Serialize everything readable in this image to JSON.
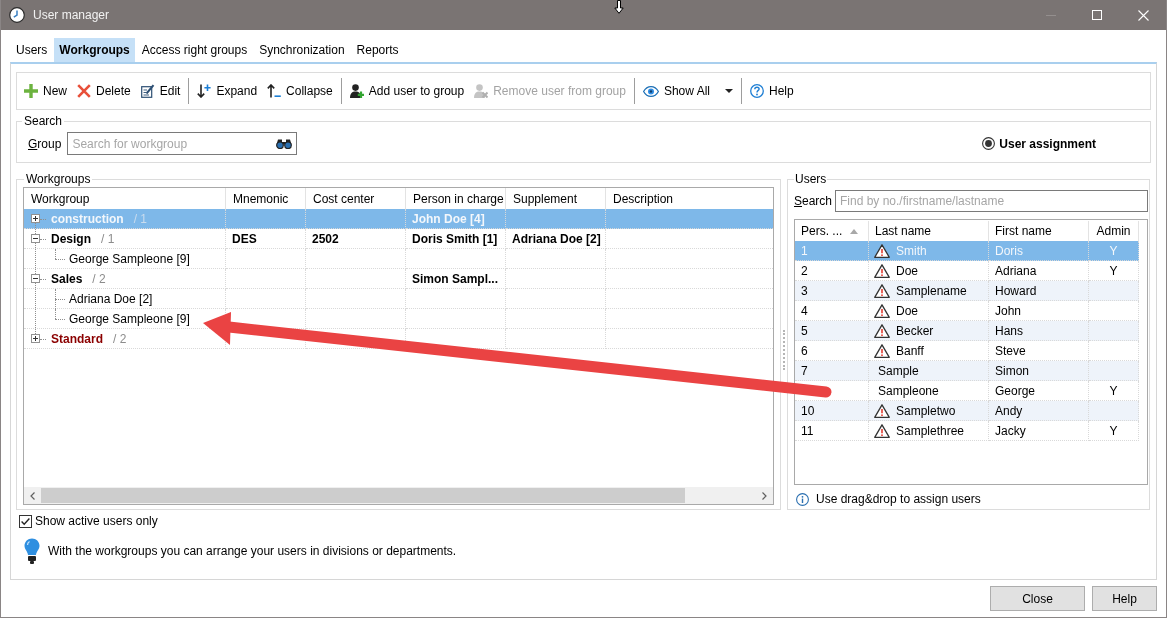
{
  "window": {
    "title": "User manager"
  },
  "tabs": [
    {
      "label": "Users",
      "selected": false
    },
    {
      "label": "Workgroups",
      "selected": true
    },
    {
      "label": "Access right groups",
      "selected": false
    },
    {
      "label": "Synchronization",
      "selected": false
    },
    {
      "label": "Reports",
      "selected": false
    }
  ],
  "toolbar": [
    {
      "items": [
        {
          "label": "New",
          "kind": "button",
          "disabled": false
        },
        {
          "label": "Delete",
          "kind": "button",
          "disabled": false
        },
        {
          "label": "Edit",
          "kind": "button",
          "disabled": false
        }
      ]
    },
    {
      "items": [
        {
          "label": "Expand",
          "kind": "button",
          "disabled": false
        },
        {
          "label": "Collapse",
          "kind": "button",
          "disabled": false
        }
      ]
    },
    {
      "items": [
        {
          "label": "Add user to group",
          "kind": "button",
          "disabled": false
        },
        {
          "label": "Remove user from group",
          "kind": "button",
          "disabled": true
        }
      ]
    },
    {
      "items": [
        {
          "label": "Show All",
          "kind": "split",
          "disabled": false
        }
      ]
    },
    {
      "items": [
        {
          "label": "Help",
          "kind": "button",
          "disabled": false
        }
      ]
    }
  ],
  "search": {
    "legend": "Search",
    "label": "Group",
    "placeholder": "Search for workgroup",
    "option": {
      "label": "User assignment",
      "selected": true
    }
  },
  "workgroups": {
    "legend": "Workgroups",
    "columns": [
      "Workgroup",
      "Mnemonic",
      "Cost center",
      "Person in charge",
      "Supplement",
      "Description"
    ],
    "groups": [
      {
        "name": "construction",
        "count": "/ 1",
        "person_in_charge": "John Doe [4]",
        "expanded": false,
        "selected": true
      },
      {
        "name": "Design",
        "count": "/ 1",
        "mnemonic": "DES",
        "cost_center": "2502",
        "person_in_charge": "Doris Smith [1]",
        "supplement": "Adriana Doe [2]",
        "expanded": true,
        "selected": false,
        "color": "#000000",
        "members": [
          {
            "name": "George Sampleone [9]",
            "selected": false
          }
        ]
      },
      {
        "name": "Sales",
        "count": "/ 2",
        "person_in_charge": "Simon Sampl...",
        "expanded": true,
        "selected": false,
        "color": "#000000",
        "members": [
          {
            "name": "Adriana Doe [2]",
            "selected": false
          },
          {
            "name": "George Sampleone [9]",
            "selected": false
          }
        ]
      },
      {
        "name": "Standard",
        "count": "/ 2",
        "expanded": false,
        "selected": false,
        "color": "#8b0000"
      }
    ]
  },
  "users": {
    "legend": "Users",
    "search_label": "Search",
    "placeholder": "Find by no./firstname/lastname",
    "columns": [
      {
        "label": "Pers. ...",
        "sorted": true
      },
      {
        "label": "Last name",
        "sorted": false
      },
      {
        "label": "First name",
        "sorted": false
      },
      {
        "label": "Admin",
        "sorted": false
      }
    ],
    "rows": [
      {
        "pers_no": "1",
        "warning": true,
        "last_name": "Smith",
        "first_name": "Doris",
        "admin": "Y",
        "selected": true
      },
      {
        "pers_no": "2",
        "warning": true,
        "last_name": "Doe",
        "first_name": "Adriana",
        "admin": "Y",
        "selected": false
      },
      {
        "pers_no": "3",
        "warning": true,
        "last_name": "Samplename",
        "first_name": "Howard",
        "selected": false
      },
      {
        "pers_no": "4",
        "warning": true,
        "last_name": "Doe",
        "first_name": "John",
        "selected": false
      },
      {
        "pers_no": "5",
        "warning": true,
        "last_name": "Becker",
        "first_name": "Hans",
        "selected": false
      },
      {
        "pers_no": "6",
        "warning": true,
        "last_name": "Banff",
        "first_name": "Steve",
        "selected": false
      },
      {
        "pers_no": "7",
        "warning": false,
        "last_name": "Sample",
        "first_name": "Simon",
        "selected": false
      },
      {
        "warning": false,
        "last_name": "Sampleone",
        "first_name": "George",
        "admin": "Y",
        "selected": false
      },
      {
        "pers_no": "10",
        "warning": true,
        "last_name": "Sampletwo",
        "first_name": "Andy",
        "selected": false
      },
      {
        "pers_no": "11",
        "warning": true,
        "last_name": "Samplethree",
        "first_name": "Jacky",
        "admin": "Y",
        "selected": false
      }
    ],
    "hint": "Use drag&drop to assign users"
  },
  "show_active_only": {
    "label": "Show active users only",
    "checked": true
  },
  "tip": "With the workgroups you can arrange your users in divisions or departments.",
  "buttons": [
    "Close",
    "Help"
  ]
}
